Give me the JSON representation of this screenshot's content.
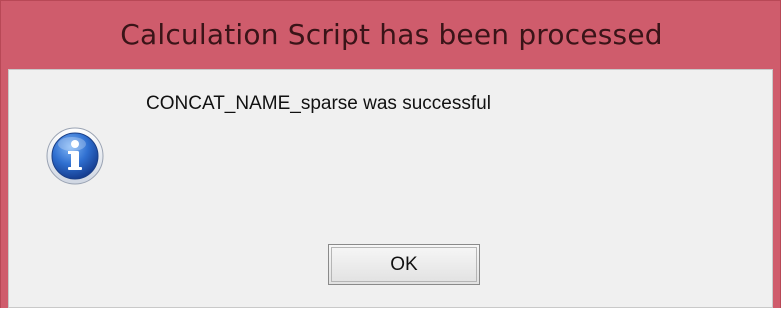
{
  "window": {
    "title": "Calculation Script has been processed",
    "accent_color": "#cf5c6c"
  },
  "dialog": {
    "icon": "info-icon",
    "message": "CONCAT_NAME_sparse was successful",
    "ok_label": "OK"
  }
}
